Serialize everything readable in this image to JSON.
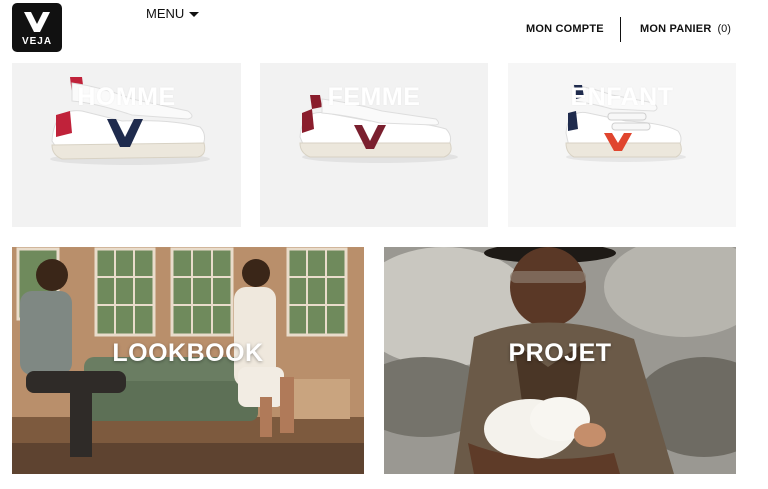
{
  "header": {
    "logo_text": "VEJA",
    "menu_label": "MENU",
    "account_label": "MON COMPTE",
    "cart_label": "MON PANIER",
    "cart_count": "(0)"
  },
  "categories": [
    {
      "title": "HOMME",
      "accent": "#1f2b4d",
      "heel": "#c0223a"
    },
    {
      "title": "FEMME",
      "accent": "#7a1f2e",
      "heel": "#8a1d2c"
    },
    {
      "title": "ENFANT",
      "accent": "#e0452e",
      "heel": "#1f2b4d"
    }
  ],
  "features": [
    {
      "title": "LOOKBOOK"
    },
    {
      "title": "PROJET"
    }
  ],
  "icons": [
    "veja-logo-icon",
    "chevron-down-icon"
  ]
}
